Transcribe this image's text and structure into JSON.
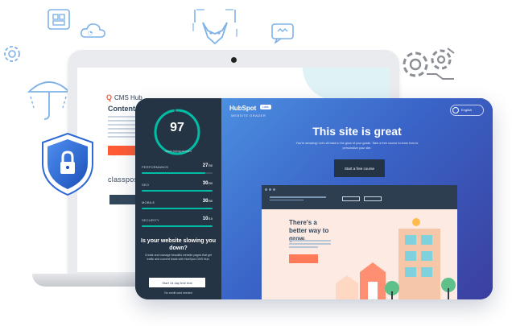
{
  "laptop": {
    "cms_logo": "CMS Hub",
    "cms_title": "Content M",
    "brand_word": "classpos"
  },
  "sidebar": {
    "score": "97",
    "website": "www.hubspot.com",
    "metrics": [
      {
        "label": "PERFORMANCE",
        "value": "27",
        "max": "/30",
        "fraction": 0.9
      },
      {
        "label": "SEO",
        "value": "30",
        "max": "/30",
        "fraction": 1.0
      },
      {
        "label": "MOBILE",
        "value": "30",
        "max": "/30",
        "fraction": 1.0
      },
      {
        "label": "SECURITY",
        "value": "10",
        "max": "/10",
        "fraction": 1.0
      }
    ],
    "question": "Is your website slowing you down?",
    "description": "Create and manage beautiful website pages that get traffic and convert leads with HubSpot CMS Hub.",
    "trial_button": "Start 14 day free trial",
    "no_cc": "No credit card needed"
  },
  "main": {
    "logo": "HubSpot",
    "beta": "Labs",
    "sub_title": "WEBSITE GRADER",
    "language": "English",
    "headline": "This site is great",
    "subline": "You're amazing! Let's all bask in the glow of your grade. Take a free course to learn how to personalize your site.",
    "course_button": "Start a free course"
  },
  "preview": {
    "headline": "There's a better way to grow."
  },
  "colors": {
    "accent_orange": "#ff5c35",
    "teal": "#00bda5",
    "sidebar_bg": "#243444"
  },
  "icons": [
    "grid-icon",
    "cloud-icon",
    "fox-icon",
    "chat-icon",
    "gear-icon",
    "umbrella-icon",
    "handshake-icon",
    "shield-lock-icon",
    "globe-icon"
  ]
}
